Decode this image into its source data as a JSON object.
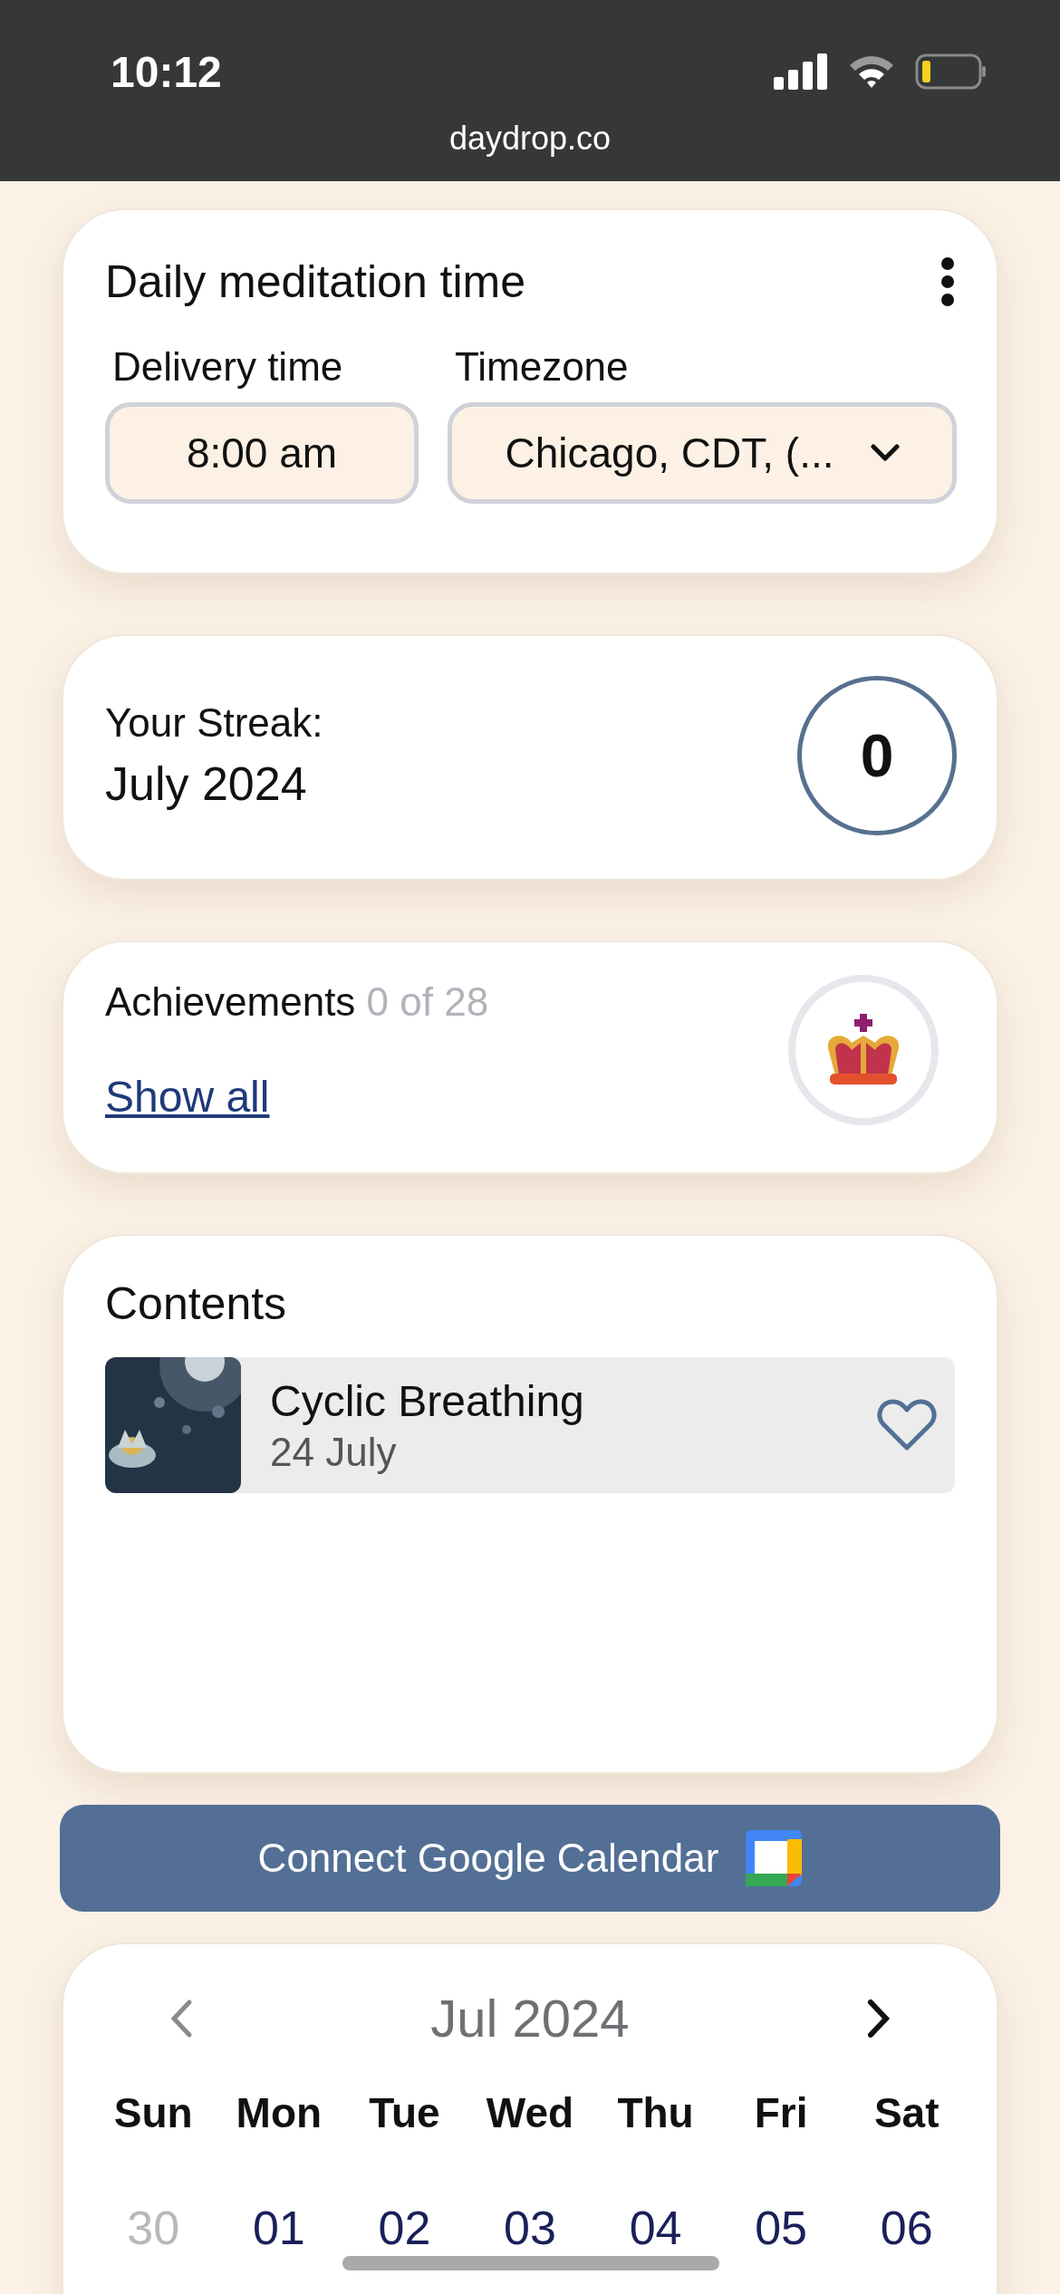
{
  "status_bar": {
    "time": "10:12"
  },
  "browser": {
    "url": "daydrop.co"
  },
  "schedule_card": {
    "title": "Daily meditation time",
    "delivery": {
      "label": "Delivery time",
      "value": "8:00 am"
    },
    "timezone": {
      "label": "Timezone",
      "value": "Chicago, CDT, (..."
    }
  },
  "streak_card": {
    "label": "Your Streak:",
    "month": "July 2024",
    "count": "0"
  },
  "achievements_card": {
    "title": "Achievements",
    "progress": "0 of 28",
    "link": "Show all"
  },
  "contents_card": {
    "title": "Contents",
    "items": [
      {
        "title": "Cyclic Breathing",
        "date": "24 July",
        "favorite": false
      }
    ]
  },
  "calendar_button": {
    "label": "Connect Google Calendar"
  },
  "calendar": {
    "month": "Jul 2024",
    "weekdays": [
      "Sun",
      "Mon",
      "Tue",
      "Wed",
      "Thu",
      "Fri",
      "Sat"
    ],
    "days": [
      {
        "label": "30",
        "in_month": false
      },
      {
        "label": "01",
        "in_month": true
      },
      {
        "label": "02",
        "in_month": true
      },
      {
        "label": "03",
        "in_month": true
      },
      {
        "label": "04",
        "in_month": true
      },
      {
        "label": "05",
        "in_month": true
      },
      {
        "label": "06",
        "in_month": true
      }
    ]
  }
}
